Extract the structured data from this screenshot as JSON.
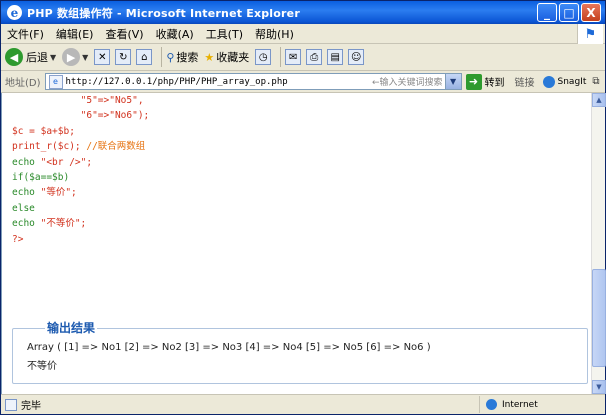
{
  "window": {
    "title": "PHP 数组操作符 - Microsoft Internet Explorer",
    "title_icon": "e",
    "min": "_",
    "max": "□",
    "close": "X"
  },
  "menu": [
    "文件(F)",
    "编辑(E)",
    "查看(V)",
    "收藏(A)",
    "工具(T)",
    "帮助(H)"
  ],
  "toolbar": {
    "back_label": "后退",
    "search_label": "搜索",
    "favorites_label": "收藏夹"
  },
  "address": {
    "label": "地址(D)",
    "url": "http://127.0.0.1/php/PHP/PHP_array_op.php",
    "hint": "←输入关键词搜索",
    "go_label": "转到",
    "links_label": "链接",
    "snagit_label": "SnagIt"
  },
  "code_lines": [
    {
      "indent": "            ",
      "parts": [
        {
          "t": "\"5\"=>\"No5\",",
          "c": "red"
        }
      ]
    },
    {
      "indent": "            ",
      "parts": [
        {
          "t": "\"6\"=>\"No6\");",
          "c": "red"
        }
      ]
    },
    {
      "indent": "",
      "parts": [
        {
          "t": "$c = $a+$b;",
          "c": "red"
        }
      ]
    },
    {
      "indent": "",
      "parts": [
        {
          "t": "print_r($c); ",
          "c": "red"
        },
        {
          "t": "//联合两数组",
          "c": "orange"
        }
      ]
    },
    {
      "indent": "",
      "parts": [
        {
          "t": "echo ",
          "c": "green"
        },
        {
          "t": "\"<br />\";",
          "c": "red"
        }
      ]
    },
    {
      "indent": "",
      "parts": [
        {
          "t": "if($a==$b)",
          "c": "green"
        }
      ]
    },
    {
      "indent": "",
      "parts": [
        {
          "t": "echo ",
          "c": "green"
        },
        {
          "t": "\"等价\";",
          "c": "red"
        }
      ]
    },
    {
      "indent": "",
      "parts": [
        {
          "t": "else",
          "c": "green"
        }
      ]
    },
    {
      "indent": "",
      "parts": [
        {
          "t": "echo ",
          "c": "green"
        },
        {
          "t": "\"不等价\";",
          "c": "red"
        }
      ]
    },
    {
      "indent": "",
      "parts": [
        {
          "t": "?>",
          "c": "red"
        }
      ]
    }
  ],
  "output": {
    "title": "输出结果",
    "line1": "Array ( [1] => No1 [2] => No2 [3] => No3 [4] => No4 [5] => No5 [6] => No6 )",
    "line2": "不等价"
  },
  "status": {
    "text": "完毕",
    "zone": "Internet"
  },
  "colors": {
    "red": "#d2321e",
    "orange": "#e6720f",
    "green": "#2a8a2a",
    "title_blue": "#0a5fe0"
  }
}
